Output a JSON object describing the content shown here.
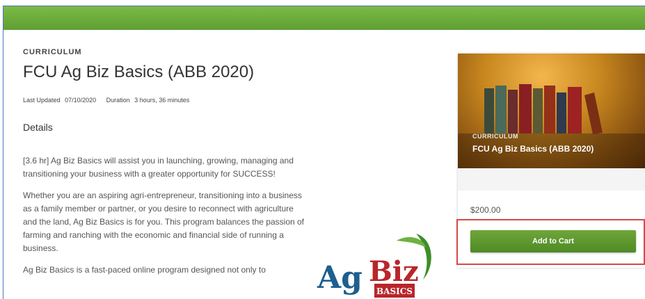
{
  "header": {
    "bar_color": "#6aac3b"
  },
  "page": {
    "eyebrow": "CURRICULUM",
    "title": "FCU Ag Biz Basics (ABB 2020)",
    "last_updated_label": "Last Updated",
    "last_updated_value": "07/10/2020",
    "duration_label": "Duration",
    "duration_value": "3 hours, 36 minutes",
    "details_heading": "Details",
    "paragraphs": [
      "[3.6 hr] Ag Biz Basics will assist you in launching, growing, managing and transitioning your business with a greater opportunity for SUCCESS!",
      "Whether you are an aspiring agri-entrepreneur, transitioning into a business as a family member or partner, or you desire to reconnect with agriculture and the land, Ag Biz Basics is for you. This program balances the passion of farming and ranching with the economic and financial side of running a business.",
      "Ag Biz Basics is a fast-paced online program designed not only to"
    ]
  },
  "logo": {
    "word1": "Ag",
    "word2": "Biz",
    "ribbon": "BASICS"
  },
  "card": {
    "tag": "CURRICULUM",
    "title": "FCU Ag Biz Basics (ABB 2020)",
    "price": "$200.00",
    "add_to_cart_label": "Add to Cart",
    "highlight_color": "#d24a4a"
  }
}
